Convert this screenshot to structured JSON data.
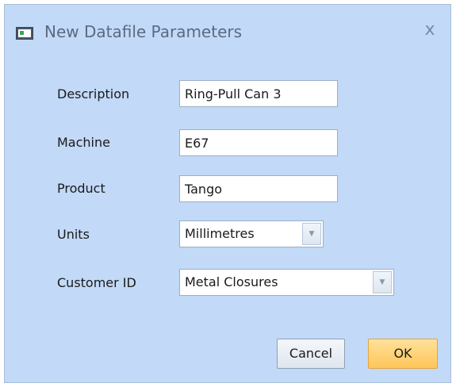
{
  "window": {
    "title": "New Datafile Parameters",
    "close_glyph": "x",
    "title_icon": "window-icon"
  },
  "form": {
    "description": {
      "label": "Description",
      "value": "Ring-Pull Can 3"
    },
    "machine": {
      "label": "Machine",
      "value": "E67"
    },
    "product": {
      "label": "Product",
      "value": "Tango"
    },
    "units": {
      "label": "Units",
      "value": "Millimetres"
    },
    "customer_id": {
      "label": "Customer ID",
      "value": "Metal Closures"
    }
  },
  "buttons": {
    "cancel": "Cancel",
    "ok": "OK"
  },
  "colors": {
    "dialog_background": "#c2d9f7",
    "ok_button": "#ffc65a",
    "title_text": "#5a6a82"
  }
}
